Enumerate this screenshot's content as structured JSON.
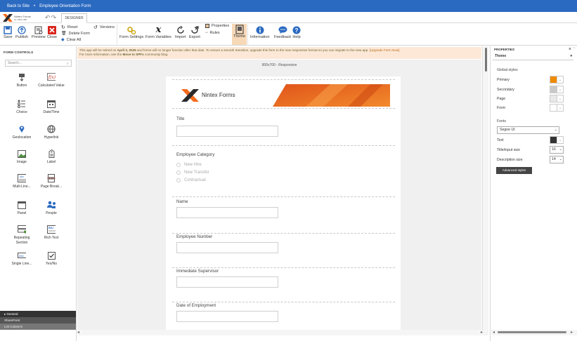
{
  "topbar": {
    "back_link": "Back to Site",
    "separator": "•",
    "breadcrumb": "Employee Orientation Form"
  },
  "logo": {
    "line1": "Nintex Forms",
    "line2": "for Office 365"
  },
  "tabs": {
    "designer": "DESIGNER"
  },
  "ribbon": {
    "save": "Save",
    "publish": "Publish",
    "preview": "Preview",
    "close": "Close",
    "reset": "Reset",
    "delete_form": "Delete Form",
    "clear_all": "Clear All",
    "versions": "Versions",
    "form_settings": "Form Settings",
    "form_variables": "Form Variables",
    "import": "Import",
    "export": "Export",
    "properties": "Properties",
    "rules": "Rules",
    "theme": "Theme",
    "information": "Information",
    "feedback": "Feedback",
    "help": "Help"
  },
  "left_panel": {
    "title": "FORM CONTROLS",
    "search_placeholder": "Search...",
    "controls": [
      {
        "label": "Button",
        "icon": "button-icon"
      },
      {
        "label": "Calculated Value",
        "icon": "calculated-value-icon"
      },
      {
        "label": "Choice",
        "icon": "choice-icon"
      },
      {
        "label": "Date/Time",
        "icon": "datetime-icon"
      },
      {
        "label": "Geolocation",
        "icon": "geolocation-icon"
      },
      {
        "label": "Hyperlink",
        "icon": "hyperlink-icon"
      },
      {
        "label": "Image",
        "icon": "image-icon"
      },
      {
        "label": "Label",
        "icon": "label-icon"
      },
      {
        "label": "Multi Line...",
        "icon": "multi-line-icon"
      },
      {
        "label": "Page Break...",
        "icon": "page-break-icon"
      },
      {
        "label": "Panel",
        "icon": "panel-icon"
      },
      {
        "label": "People",
        "icon": "people-icon"
      },
      {
        "label": "Repeating Section",
        "icon": "repeating-section-icon"
      },
      {
        "label": "Rich Text",
        "icon": "rich-text-icon"
      },
      {
        "label": "Single Line...",
        "icon": "single-line-icon"
      },
      {
        "label": "Yes/No",
        "icon": "yes-no-icon"
      }
    ],
    "categories": [
      "General",
      "SharePoint",
      "List Columns"
    ]
  },
  "banner": {
    "text1": "This app will be retired on ",
    "date": "April 2, 2026",
    "text2": " and forms will no longer function after that date. To ensure a smooth transition, upgrade this form to the new responsive format so you can migrate to the new app. ",
    "link": "[Upgrade Form Now]",
    "text3": "For more information, see the ",
    "blog": "Move to SPFx",
    "text4": " community blog."
  },
  "canvas": {
    "size_label": "900x700 - Responsive"
  },
  "form": {
    "logo_text": "Nintex Forms",
    "fields": {
      "title": "Title",
      "employee_category": "Employee Category",
      "options": [
        "New Hire",
        "New Transfer",
        "Contractual"
      ],
      "name": "Name",
      "employee_number": "Employee Number",
      "immediate_supervisor": "Immediate Supervisor",
      "date_of_employment": "Date of Employment"
    }
  },
  "right_panel": {
    "title": "PROPERTIES",
    "section": "Theme",
    "global_styles": "Global styles",
    "primary": "Primary",
    "secondary": "Secondary",
    "page": "Page",
    "form": "Form",
    "fonts": "Fonts",
    "font_family": "Segoe UI",
    "text": "Text",
    "title_input_size_label": "Title/input size",
    "title_input_size": "16",
    "description_size_label": "Description size",
    "description_size": "14",
    "advanced_styles": "Advanced styles",
    "colors": {
      "primary": "#f08a00",
      "secondary": "#c9c9c9",
      "page": "#e8e8e8",
      "form": "#ffffff",
      "text": "#333333"
    }
  }
}
